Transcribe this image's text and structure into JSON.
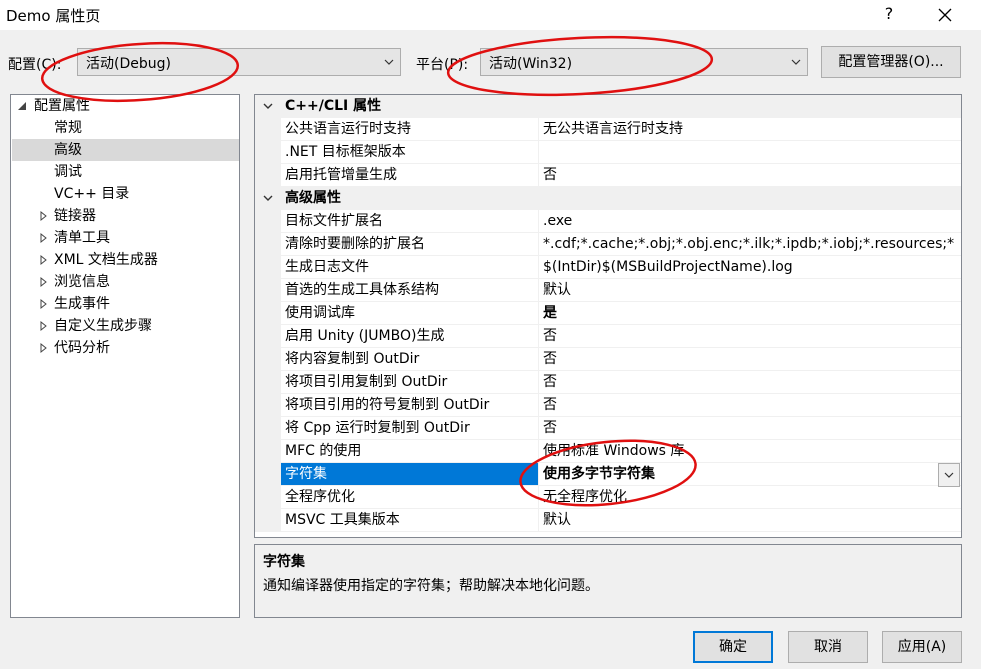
{
  "window": {
    "title": "Demo 属性页",
    "help_label": "?"
  },
  "config": {
    "label": "配置(C):",
    "value": "活动(Debug)"
  },
  "platform": {
    "label": "平台(P):",
    "value": "活动(Win32)"
  },
  "config_manager_label": "配置管理器(O)...",
  "tree": {
    "root": "配置属性",
    "items": [
      {
        "label": "常规",
        "expandable": false
      },
      {
        "label": "高级",
        "expandable": false,
        "selected": true
      },
      {
        "label": "调试",
        "expandable": false
      },
      {
        "label": "VC++ 目录",
        "expandable": false
      },
      {
        "label": "链接器",
        "expandable": true
      },
      {
        "label": "清单工具",
        "expandable": true
      },
      {
        "label": "XML 文档生成器",
        "expandable": true
      },
      {
        "label": "浏览信息",
        "expandable": true
      },
      {
        "label": "生成事件",
        "expandable": true
      },
      {
        "label": "自定义生成步骤",
        "expandable": true
      },
      {
        "label": "代码分析",
        "expandable": true
      }
    ]
  },
  "grid": {
    "categories": [
      {
        "name": "C++/CLI 属性",
        "rows": [
          {
            "name": "公共语言运行时支持",
            "value": "无公共语言运行时支持"
          },
          {
            "name": ".NET 目标框架版本",
            "value": ""
          },
          {
            "name": "启用托管增量生成",
            "value": "否"
          }
        ]
      },
      {
        "name": "高级属性",
        "rows": [
          {
            "name": "目标文件扩展名",
            "value": ".exe"
          },
          {
            "name": "清除时要删除的扩展名",
            "value": "*.cdf;*.cache;*.obj;*.obj.enc;*.ilk;*.ipdb;*.iobj;*.resources;*"
          },
          {
            "name": "生成日志文件",
            "value": "$(IntDir)$(MSBuildProjectName).log"
          },
          {
            "name": "首选的生成工具体系结构",
            "value": "默认"
          },
          {
            "name": "使用调试库",
            "value": "是"
          },
          {
            "name": "启用 Unity (JUMBO)生成",
            "value": "否"
          },
          {
            "name": "将内容复制到 OutDir",
            "value": "否"
          },
          {
            "name": "将项目引用复制到 OutDir",
            "value": "否"
          },
          {
            "name": "将项目引用的符号复制到 OutDir",
            "value": "否"
          },
          {
            "name": "将 Cpp 运行时复制到 OutDir",
            "value": "否"
          },
          {
            "name": "MFC 的使用",
            "value": "使用标准 Windows 库"
          },
          {
            "name": "字符集",
            "value": "使用多字节字符集"
          },
          {
            "name": "全程序优化",
            "value": "无全程序优化"
          },
          {
            "name": "MSVC 工具集版本",
            "value": "默认"
          }
        ]
      }
    ]
  },
  "description": {
    "title": "字符集",
    "text": "通知编译器使用指定的字符集；帮助解决本地化问题。"
  },
  "buttons": {
    "ok": "确定",
    "cancel": "取消",
    "apply": "应用(A)"
  },
  "colors": {
    "selection": "#0078d7",
    "annotation": "#e01010"
  }
}
